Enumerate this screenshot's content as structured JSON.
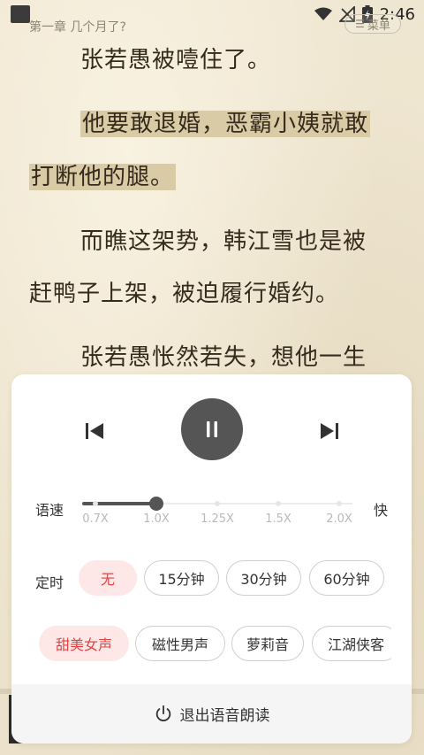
{
  "status_bar": {
    "time": "2:46"
  },
  "header": {
    "chapter_title": "第一章 几个月了?",
    "menu_label": "菜单"
  },
  "reading": {
    "lines": [
      "张若愚被噎住了。",
      "他要敢退婚，恶霸小姨就敢",
      "打断他的腿。",
      "而瞧这架势，韩江雪也是被",
      "赶鸭子上架，被迫履行婚约。",
      "张若愚怅然若失，想他一生"
    ],
    "highlight_color": "#d8cba5"
  },
  "player": {
    "state": "playing",
    "speed": {
      "label": "语速",
      "fast_label": "快",
      "options": [
        "0.7X",
        "1.0X",
        "1.25X",
        "1.5X",
        "2.0X"
      ],
      "selected_index": 1
    },
    "timer": {
      "label": "定时",
      "options": [
        "无",
        "15分钟",
        "30分钟",
        "60分钟"
      ],
      "selected_index": 0
    },
    "voices": {
      "options": [
        "甜美女声",
        "磁性男声",
        "萝莉音",
        "江湖侠客"
      ],
      "selected_index": 0
    },
    "exit_label": "退出语音朗读",
    "accent_color": "#e04545",
    "accent_bg": "#fde7e7"
  }
}
